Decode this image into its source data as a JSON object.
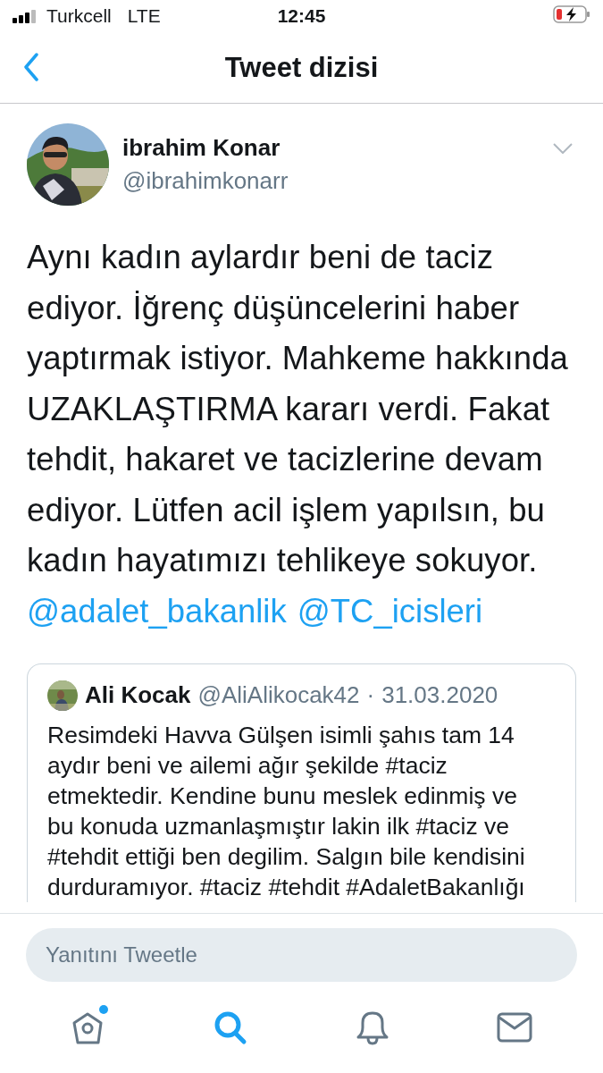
{
  "status_bar": {
    "carrier": "Turkcell",
    "network": "LTE",
    "time": "12:45"
  },
  "nav": {
    "title": "Tweet dizisi"
  },
  "tweet": {
    "author": {
      "name": "ibrahim Konar",
      "handle": "@ibrahimkonarr"
    },
    "text": "Aynı kadın aylardır beni de taciz ediyor. İğrenç düşüncelerini haber yaptırmak istiyor. Mahkeme hakkında UZAKLAŞTIRMA kararı verdi. Fakat tehdit, hakaret ve tacizlerine devam ediyor. Lütfen acil işlem yapılsın, bu kadın hayatımızı tehlikeye sokuyor.",
    "mentions": [
      "@adalet_bakanlik",
      "@TC_icisleri"
    ],
    "quoted": {
      "name": "Ali Kocak",
      "handle": "@AliAlikocak42",
      "separator": "·",
      "date": "31.03.2020",
      "text": "Resimdeki Havva Gülşen isimli şahıs tam 14 aydır beni ve ailemi ağır şekilde #taciz etmektedir. Kendine bunu meslek edinmiş ve bu konuda uzmanlaşmıştır lakin ilk #taciz ve #tehdit ettiği ben degilim. Salgın bile kendisini durduramıyor. #taciz #tehdit #AdaletBakanlığı"
    }
  },
  "reply": {
    "placeholder": "Yanıtını Tweetle"
  },
  "tabs": [
    {
      "kind": "home",
      "selected": false,
      "badge": true
    },
    {
      "kind": "search",
      "selected": true,
      "badge": false
    },
    {
      "kind": "notifications",
      "selected": false,
      "badge": false
    },
    {
      "kind": "messages",
      "selected": false,
      "badge": false
    }
  ]
}
